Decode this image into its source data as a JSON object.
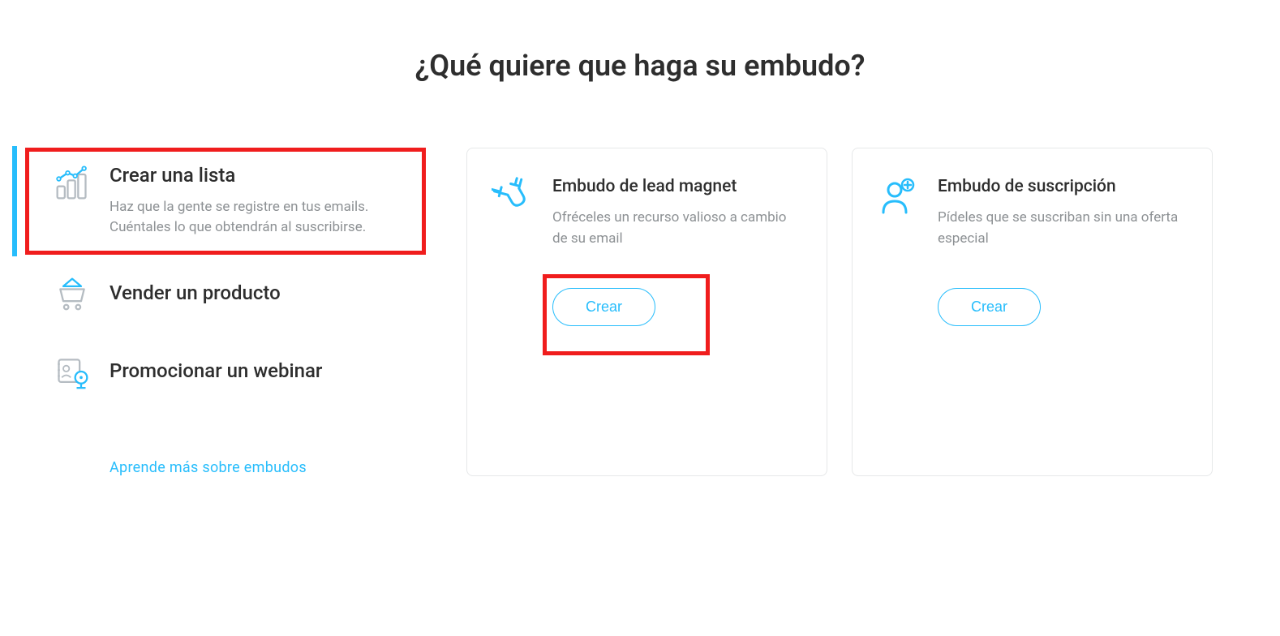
{
  "page_title": "¿Qué quiere que haga su embudo?",
  "sidebar": {
    "items": [
      {
        "title": "Crear una lista",
        "description": "Haz que la gente se registre en tus emails. Cuéntales lo que obtendrán al suscribirse."
      },
      {
        "title": "Vender un producto"
      },
      {
        "title": "Promocionar un webinar"
      }
    ]
  },
  "learn_more": "Aprende más sobre embudos",
  "cards": [
    {
      "title": "Embudo de lead magnet",
      "description": "Ofréceles un recurso valioso a cambio de su email",
      "button": "Crear"
    },
    {
      "title": "Embudo de suscripción",
      "description": "Pídeles que se suscriban sin una oferta especial",
      "button": "Crear"
    }
  ],
  "colors": {
    "accent": "#27bdfc",
    "icon_gray": "#b5bcc2",
    "highlight": "#f01d1d"
  }
}
